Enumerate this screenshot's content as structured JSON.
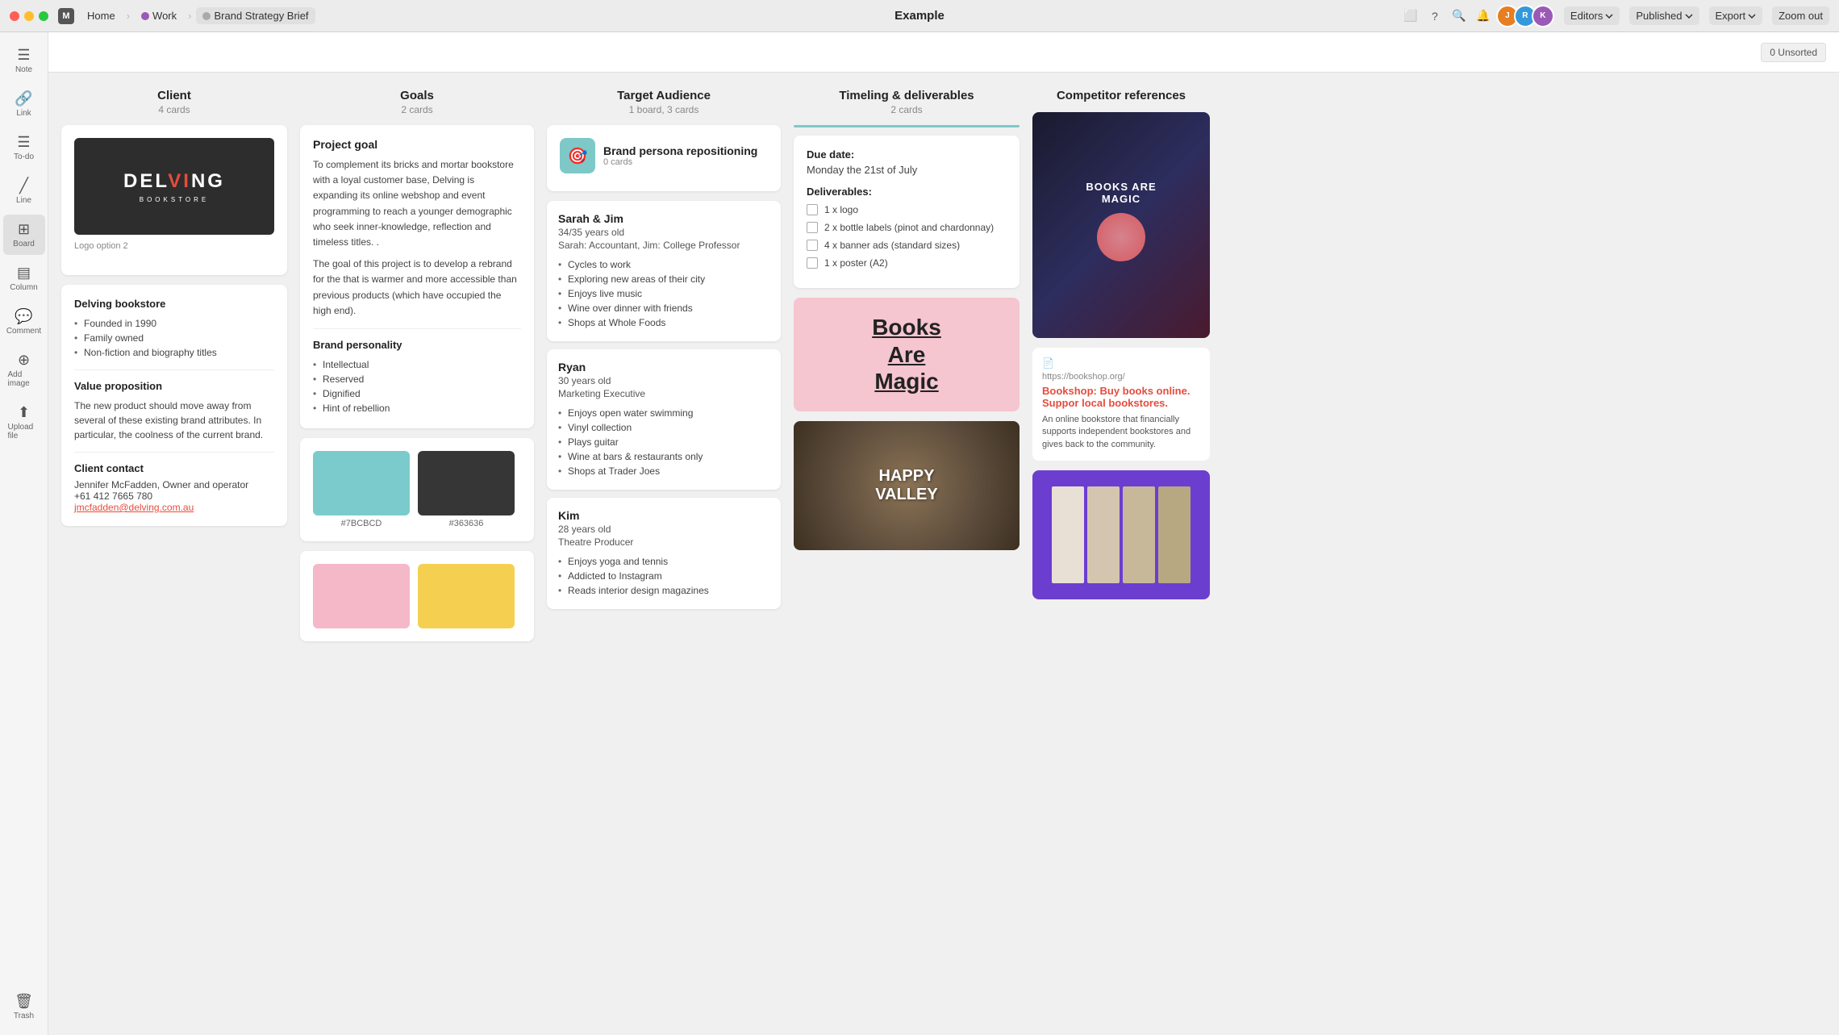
{
  "titlebar": {
    "title": "Example",
    "nav": {
      "home": "Home",
      "work": "Work",
      "doc": "Brand Strategy Brief"
    },
    "editors_label": "Editors",
    "published_label": "Published",
    "export_label": "Export",
    "zoom_label": "Zoom out"
  },
  "toolbar": {
    "unsorted": "0 Unsorted"
  },
  "sidebar": {
    "items": [
      {
        "id": "note",
        "label": "Note",
        "icon": "≡"
      },
      {
        "id": "link",
        "label": "Link",
        "icon": "🔗"
      },
      {
        "id": "todo",
        "label": "To-do",
        "icon": "☰"
      },
      {
        "id": "line",
        "label": "Line",
        "icon": "/"
      },
      {
        "id": "board",
        "label": "Board",
        "icon": "⊞"
      },
      {
        "id": "column",
        "label": "Column",
        "icon": "≡"
      },
      {
        "id": "comment",
        "label": "Comment",
        "icon": "💬"
      },
      {
        "id": "image",
        "label": "Add image",
        "icon": "⊕"
      },
      {
        "id": "file",
        "label": "Upload file",
        "icon": "⬆"
      }
    ],
    "trash_label": "Trash"
  },
  "columns": [
    {
      "id": "client",
      "title": "Client",
      "count": "4 cards",
      "has_accent": false
    },
    {
      "id": "goals",
      "title": "Goals",
      "count": "2 cards",
      "has_accent": false
    },
    {
      "id": "target_audience",
      "title": "Target Audience",
      "count": "1 board, 3 cards",
      "has_accent": false
    },
    {
      "id": "timeline",
      "title": "Timeling & deliverables",
      "count": "2 cards",
      "has_accent": true
    },
    {
      "id": "competitor",
      "title": "Competitor references",
      "count": ""
    }
  ],
  "client": {
    "logo_text": "DELV",
    "logo_v": "I",
    "logo_ng": "NG",
    "logo_sub": "BOOKSTORE",
    "logo_caption": "Logo option 2",
    "bookstore": {
      "name": "Delving bookstore",
      "facts": [
        "Founded in 1990",
        "Family owned",
        "Non-fiction and biography titles"
      ]
    },
    "value_proposition": {
      "title": "Value proposition",
      "text": "The new product should move away from several of these existing brand attributes. In particular, the coolness of the current brand."
    },
    "contact": {
      "title": "Client contact",
      "name": "Jennifer McFadden, Owner and operator",
      "phone": "+61 412 7665 780",
      "email": "jmcfadden@delving.com.au"
    }
  },
  "goals": {
    "project_goal": {
      "title": "Project goal",
      "text1": "To complement its bricks and mortar bookstore with a loyal customer base, Delving is expanding its online webshop and event programming to reach a younger demographic who seek inner-knowledge, reflection and timeless titles. .",
      "text2": "The goal of this project is to develop a rebrand for the  that is warmer and more accessible than previous products (which have occupied the high end)."
    },
    "brand_personality": {
      "title": "Brand personality",
      "traits": [
        "Intellectual",
        "Reserved",
        "Dignified",
        "Hint of rebellion"
      ]
    },
    "colors": [
      {
        "hex": "#7BCBCD",
        "label": "#7BCBCD"
      },
      {
        "hex": "#363636",
        "label": "#363636"
      }
    ],
    "colors2": [
      {
        "hex": "#f4b8c8",
        "label": ""
      },
      {
        "hex": "#f5d050",
        "label": ""
      }
    ]
  },
  "target_audience": {
    "board_card": {
      "title": "Brand persona repositioning",
      "count": "0 cards"
    },
    "people": [
      {
        "name": "Sarah & Jim",
        "age": "34/35 years old",
        "job": "Sarah: Accountant, Jim: College Professor",
        "interests": [
          "Cycles to work",
          "Exploring new areas of their city",
          "Enjoys live music",
          "Wine over dinner with friends",
          "Shops at Whole Foods"
        ]
      },
      {
        "name": "Ryan",
        "age": "30 years old",
        "job": "Marketing Executive",
        "interests": [
          "Enjoys open water swimming",
          "Vinyl collection",
          "Plays guitar",
          "Wine at bars & restaurants only",
          "Shops at Trader Joes"
        ]
      },
      {
        "name": "Kim",
        "age": "28 years old",
        "job": "Theatre Producer",
        "interests": [
          "Enjoys yoga and tennis",
          "Addicted to Instagram",
          "Reads interior design magazines"
        ]
      }
    ]
  },
  "timeline": {
    "due_date_label": "Due date:",
    "due_date": "Monday the 21st of July",
    "deliverables_label": "Deliverables:",
    "items": [
      {
        "text": "1 x logo",
        "checked": false
      },
      {
        "text": "2 x bottle labels (pinot and chardonnay)",
        "checked": false
      },
      {
        "text": "4 x banner ads (standard sizes)",
        "checked": false
      },
      {
        "text": "1 x poster (A2)",
        "checked": false
      }
    ],
    "books_magic": "Books\nAre\nMagic",
    "happy_valley": "HAPPY\nVALLEY"
  },
  "competitor": {
    "title": "Competitor references",
    "link1": {
      "url": "https://bookshop.org/",
      "title": "Bookshop: Buy books online. Suppor local bookstores.",
      "desc": "An online bookstore that financially supports independent bookstores and gives back to the community."
    }
  }
}
